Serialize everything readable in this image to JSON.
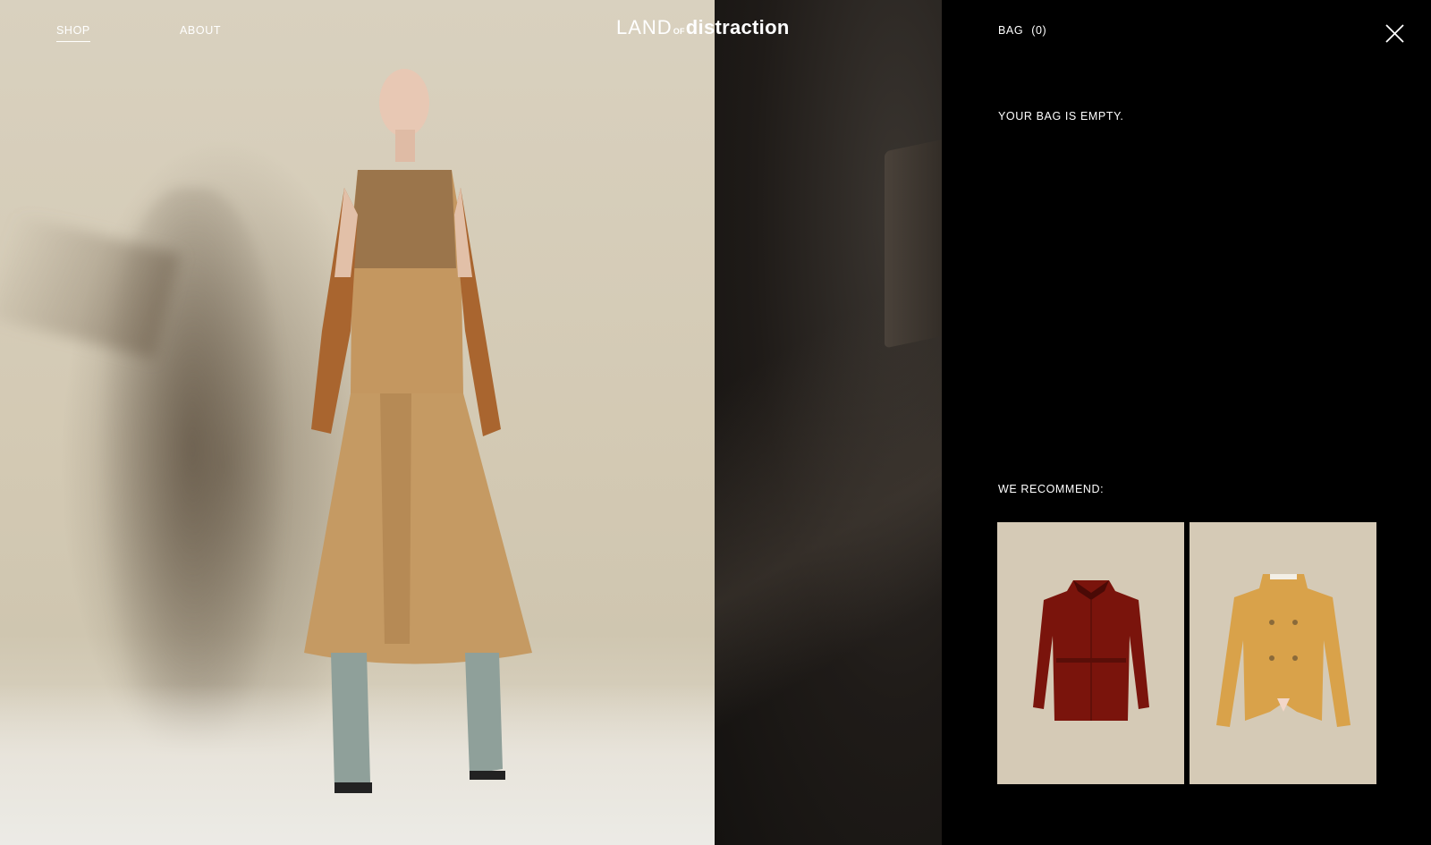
{
  "nav": {
    "shop": "SHOP",
    "about": "ABOUT"
  },
  "logo": {
    "land": "LAND",
    "of": "OF",
    "distraction": "distraction"
  },
  "bag": {
    "title": "BAG",
    "count": "(0)",
    "empty_message": "YOUR BAG IS EMPTY.",
    "recommend_title": "WE RECOMMEND:",
    "close_icon": "close-icon"
  },
  "recommendations": [
    {
      "icon": "burgundy-shirt-jacket-image",
      "color": "#7a140c"
    },
    {
      "icon": "camel-double-breasted-jacket-image",
      "color": "#d9a24a"
    }
  ],
  "colors": {
    "panel_background": "#000000",
    "text": "#ffffff",
    "card_background": "#d5cab6"
  }
}
